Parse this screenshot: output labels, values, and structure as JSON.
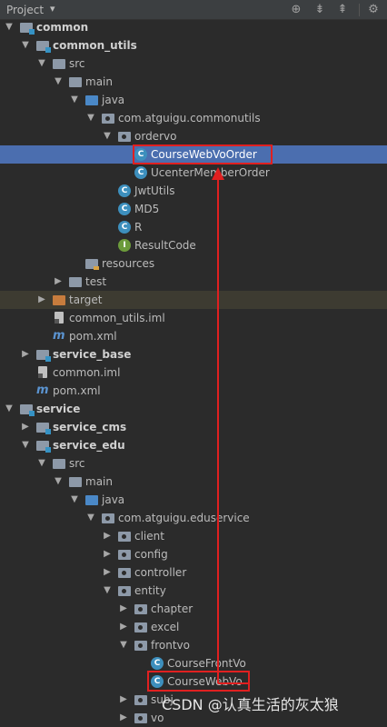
{
  "toolbar": {
    "title": "Project",
    "caret": "▾",
    "icons": [
      "globe-icon",
      "expand-all-icon",
      "collapse-all-icon",
      "settings-icon"
    ]
  },
  "tree": {
    "common": "common",
    "common_utils": "common_utils",
    "src1": "src",
    "main1": "main",
    "java1": "java",
    "pkg1": "com.atguigu.commonutils",
    "ordervo": "ordervo",
    "course_web_vo_order": "CourseWebVoOrder",
    "ucenter_member_order": "UcenterMemberOrder",
    "jwt_utils": "JwtUtils",
    "md5": "MD5",
    "r": "R",
    "result_code": "ResultCode",
    "resources": "resources",
    "test": "test",
    "target": "target",
    "common_utils_iml": "common_utils.iml",
    "pom1": "pom.xml",
    "service_base": "service_base",
    "common_iml": "common.iml",
    "pom2": "pom.xml",
    "service": "service",
    "service_cms": "service_cms",
    "service_edu": "service_edu",
    "src2": "src",
    "main2": "main",
    "java2": "java",
    "pkg2": "com.atguigu.eduservice",
    "client": "client",
    "config": "config",
    "controller": "controller",
    "entity": "entity",
    "chapter": "chapter",
    "excel": "excel",
    "frontvo": "frontvo",
    "course_front_vo": "CourseFrontVo",
    "course_web_vo": "CourseWebVo",
    "subject": "subj",
    "vo": "vo"
  },
  "watermark": "CSDN @认真生活的灰太狼",
  "colors": {
    "selection": "#4b6eaf",
    "annotation": "#e02020",
    "background": "#2b2b2b"
  }
}
